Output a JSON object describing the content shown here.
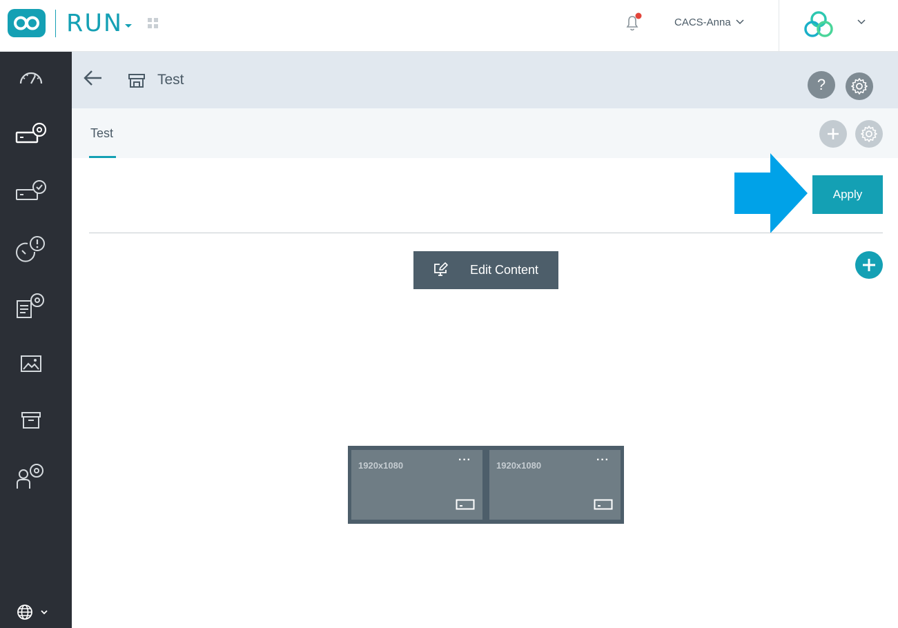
{
  "topbar": {
    "app_name": "RUN",
    "account_name": "CACS-Anna"
  },
  "page_header": {
    "title": "Test",
    "help_label": "?"
  },
  "tabs": [
    {
      "label": "Test",
      "active": true
    }
  ],
  "main": {
    "apply_label": "Apply",
    "edit_content_label": "Edit Content"
  },
  "screens": [
    {
      "resolution": "1920x1080",
      "menu": "···"
    },
    {
      "resolution": "1920x1080",
      "menu": "···"
    }
  ],
  "colors": {
    "accent": "#14a0b4",
    "sidebar": "#2b2f36",
    "header_bg": "#e1e8ef",
    "hint_arrow": "#00a2e8",
    "notification_dot": "#e2453b"
  },
  "icons": {
    "sidebar": [
      "dashboard-icon",
      "device-settings-icon",
      "device-check-icon",
      "alerts-icon",
      "reports-settings-icon",
      "media-icon",
      "archive-icon",
      "user-settings-icon"
    ],
    "footer": "globe-icon"
  }
}
